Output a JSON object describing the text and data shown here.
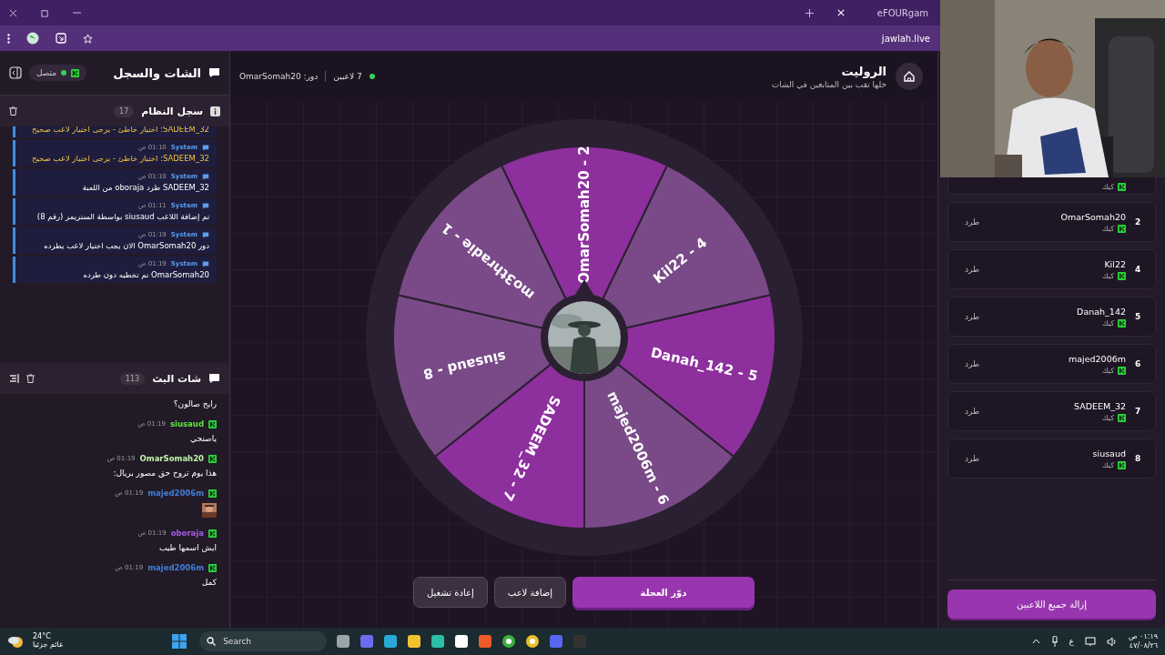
{
  "browser": {
    "tab_title": "eFOURgam",
    "url": "jawlah.live"
  },
  "chat_panel": {
    "title": "الشات والسجل",
    "status": "متصل",
    "connected": true
  },
  "system_log": {
    "title": "سجل النظام",
    "count": "17",
    "entries": [
      {
        "kind": "error",
        "text": "SADEEM_32: اختيار خاطئ - يرجى اختيار لاعب صحيح"
      },
      {
        "kind": "error",
        "author": "System",
        "time": "01:10 ص",
        "text": "SADEEM_32: اختيار خاطئ - يرجى اختيار لاعب صحيح"
      },
      {
        "kind": "info",
        "author": "System",
        "time": "01:10 ص",
        "text": "SADEEM_32 طرد oboraja من اللعبة"
      },
      {
        "kind": "info",
        "author": "System",
        "time": "01:11 ص",
        "text": "تم إضافة اللاعب siusaud بواسطة الستريمر (رقم 8)"
      },
      {
        "kind": "info",
        "author": "System",
        "time": "01:19 ص",
        "text": "دور OmarSomah20 الان يجب اختيار لاعب يطرده"
      },
      {
        "kind": "info",
        "author": "System",
        "time": "01:19 ص",
        "text": "OmarSomah20 تم تخطيه دون طرده"
      }
    ]
  },
  "stream_chat": {
    "title": "شات البث",
    "count": "113",
    "messages": [
      {
        "kind": "text",
        "text": "رايح صالون؟"
      },
      {
        "kind": "text",
        "user": "siusaud",
        "color": "#5ee63a",
        "time": "01:19 ص",
        "text": "ياصنجي"
      },
      {
        "kind": "text",
        "user": "OmarSomah20",
        "color": "#bdf5a8",
        "time": "01:19 ص",
        "text": "هذا يوم تروح حق مصور بريال:"
      },
      {
        "user": "majed2006m",
        "color": "#3f7fd6",
        "time": "01:19 ص"
      },
      {
        "kind": "text",
        "user": "oboraja",
        "color": "#a25ce0",
        "time": "01:19 ص",
        "text": "ايش اسمها طيب"
      },
      {
        "kind": "text",
        "user": "majed2006m",
        "color": "#3f7fd6",
        "time": "01:19 ص",
        "text": "كمل"
      }
    ]
  },
  "roulette": {
    "title": "الروليت",
    "subtitle": "خلها تقب بين المتابعين في الشات",
    "players_count": "7 لاعبين",
    "turn": "دور: OmarSomah20"
  },
  "wheel": {
    "segments": [
      {
        "label": "OmarSomah20 - 2",
        "color": "#8e2f9e"
      },
      {
        "label": "Kil22 - 4",
        "color": "#7a4a88"
      },
      {
        "label": "Danah_142 - 5",
        "color": "#8e2f9e"
      },
      {
        "label": "majed2006m - 6",
        "color": "#7a4a88"
      },
      {
        "label": "SADEEM_32 - 7",
        "color": "#8e2f9e"
      },
      {
        "label": "siusaud - 8",
        "color": "#7a4a88"
      },
      {
        "label": "mo3thradie - 1",
        "color": "#7a4a88"
      }
    ]
  },
  "actions": [
    {
      "kind": "primary",
      "label": "دوّر العجلة"
    },
    {
      "kind": "secondary",
      "label": "إضافة لاعب"
    },
    {
      "kind": "secondary",
      "label": "إعادة تشغيل"
    }
  ],
  "players": {
    "items": [
      {
        "platform": "كيك"
      },
      {
        "rank": "2",
        "name": "OmarSomah20",
        "platform": "كيك",
        "action": "طرد"
      },
      {
        "rank": "4",
        "name": "Kil22",
        "platform": "كيك",
        "action": "طرد"
      },
      {
        "rank": "5",
        "name": "Danah_142",
        "platform": "كيك",
        "action": "طرد"
      },
      {
        "rank": "6",
        "name": "majed2006m",
        "platform": "كيك",
        "action": "طرد"
      },
      {
        "rank": "7",
        "name": "SADEEM_32",
        "platform": "كيك",
        "action": "طرد"
      },
      {
        "rank": "8",
        "name": "siusaud",
        "platform": "كيك",
        "action": "طرد"
      }
    ],
    "remove_all": "إزالة جميع اللاعبين"
  },
  "taskbar": {
    "temperature": "24°C",
    "weather": "غائم جزئيا",
    "search": "Search",
    "language": "ع",
    "time": "٠١:١٩ ص",
    "date": "٤٧/٠٨/٢٦"
  }
}
